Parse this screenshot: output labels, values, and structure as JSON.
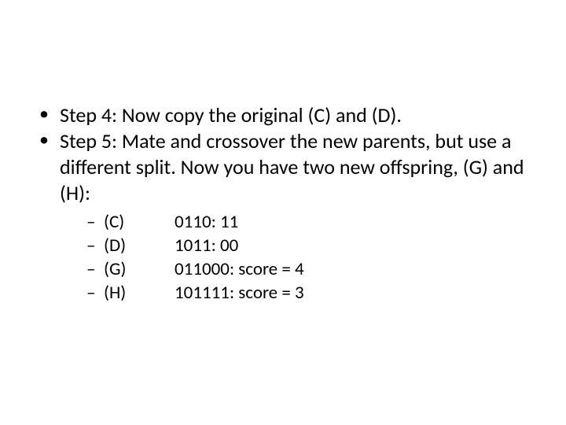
{
  "bullets": [
    {
      "text": "Step 4: Now copy the original (C) and (D)."
    },
    {
      "text": "Step 5: Mate and crossover the new parents, but use a different split. Now you have two new offspring, (G) and (H):",
      "sub": [
        {
          "label": "(C)",
          "value": "0110: 11"
        },
        {
          "label": "(D)",
          "value": "1011: 00"
        },
        {
          "label": "(G)",
          "value": "011000: score = 4"
        },
        {
          "label": "(H)",
          "value": "101111: score = 3"
        }
      ]
    }
  ]
}
